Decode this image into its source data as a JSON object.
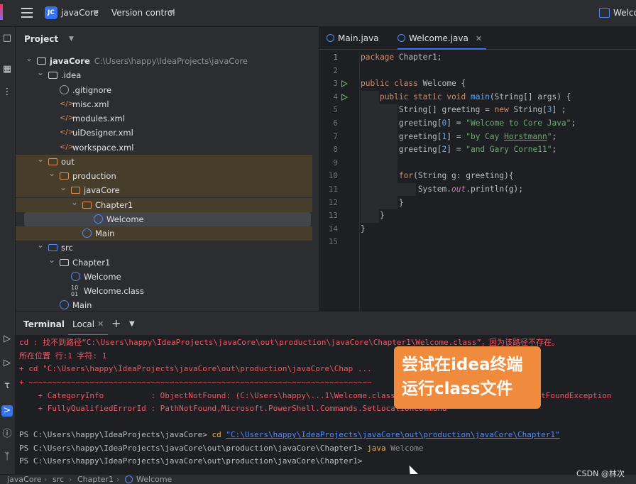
{
  "titlebar": {
    "project_badge": "JC",
    "project_name": "javaCore",
    "vcs_label": "Version control",
    "right_label": "Welcome"
  },
  "project_panel": {
    "title": "Project",
    "tree": [
      {
        "label": "javaCore",
        "path": "C:\\Users\\happy\\IdeaProjects\\javaCore",
        "depth": 0,
        "type": "module",
        "expanded": true
      },
      {
        "label": ".idea",
        "depth": 1,
        "type": "folder",
        "expanded": true
      },
      {
        "label": ".gitignore",
        "depth": 2,
        "type": "ignore"
      },
      {
        "label": "misc.xml",
        "depth": 2,
        "type": "xml"
      },
      {
        "label": "modules.xml",
        "depth": 2,
        "type": "xml"
      },
      {
        "label": "uiDesigner.xml",
        "depth": 2,
        "type": "xml"
      },
      {
        "label": "workspace.xml",
        "depth": 2,
        "type": "xml"
      },
      {
        "label": "out",
        "depth": 1,
        "type": "folder-orange",
        "expanded": true,
        "highlight": true
      },
      {
        "label": "production",
        "depth": 2,
        "type": "folder-orange",
        "expanded": true,
        "highlight": true
      },
      {
        "label": "javaCore",
        "depth": 3,
        "type": "folder-orange",
        "expanded": true,
        "highlight": true
      },
      {
        "label": "Chapter1",
        "depth": 4,
        "type": "folder-orange",
        "expanded": true,
        "highlight": true
      },
      {
        "label": "Welcome",
        "depth": 5,
        "type": "class",
        "selected": true
      },
      {
        "label": "Main",
        "depth": 4,
        "type": "class",
        "highlight": true
      },
      {
        "label": "src",
        "depth": 1,
        "type": "folder-blue",
        "expanded": true
      },
      {
        "label": "Chapter1",
        "depth": 2,
        "type": "package",
        "expanded": true
      },
      {
        "label": "Welcome",
        "depth": 3,
        "type": "class"
      },
      {
        "label": "Welcome.class",
        "depth": 3,
        "type": "binary"
      },
      {
        "label": "Main",
        "depth": 2,
        "type": "class"
      }
    ]
  },
  "editor": {
    "tabs": [
      {
        "label": "Main.java",
        "active": false
      },
      {
        "label": "Welcome.java",
        "active": true
      }
    ],
    "line_numbers": [
      "1",
      "2",
      "3",
      "4",
      "5",
      "6",
      "7",
      "8",
      "9",
      "10",
      "11",
      "12",
      "13",
      "14",
      "15"
    ],
    "run_marker_lines": [
      3,
      4
    ],
    "current_line": 1
  },
  "terminal": {
    "title": "Terminal",
    "tab_label": "Local",
    "lines": [
      "cd : 找不到路径“C:\\Users\\happy\\IdeaProjects\\javaCore\\out\\production\\javaCore\\Chapter1\\Welcome.class”，因为该路径不存在。",
      "所在位置 行:1 字符: 1",
      "+ cd \"C:\\Users\\happy\\IdeaProjects\\javaCore\\out\\production\\javaCore\\Chap ...",
      "+ ~~~~~~~~~~~~~~~~~~~~~~~~~~~~~~~~~~~~~~~~~~~~~~~~~~~~~~~~~~~~~~~~~~~~~~~~~",
      "    + CategoryInfo          : ObjectNotFound: (C:\\Users\\happy\\...1\\Welcome.class:String) [Set-Location], ItemNotFoundException",
      "    + FullyQualifiedErrorId : PathNotFound,Microsoft.PowerShell.Commands.SetLocationCommand",
      "",
      "PS C:\\Users\\happy\\IdeaProjects\\javaCore> ",
      "PS C:\\Users\\happy\\IdeaProjects\\javaCore\\out\\production\\javaCore\\Chapter1> ",
      "PS C:\\Users\\happy\\IdeaProjects\\javaCore\\out\\production\\javaCore\\Chapter1> "
    ],
    "cmd_cd": "cd ",
    "cmd_cd_path": "\"C:\\Users\\happy\\IdeaProjects\\javaCore\\out\\production\\javaCore\\Chapter1\"",
    "cmd_java": "java",
    "cmd_java_arg": " Welcome"
  },
  "annotation": {
    "line1": "尝试在idea终端",
    "line2": "运行class文件"
  },
  "statusbar": {
    "crumbs": [
      "javaCore",
      "src",
      "Chapter1",
      "Welcome"
    ]
  },
  "watermark": "CSDN @林次",
  "colors": {
    "accent": "#3574f0",
    "annotation_bg": "#f08a3c",
    "error_text": "#f75464",
    "keyword": "#cf8e6d",
    "string": "#6aab73"
  }
}
